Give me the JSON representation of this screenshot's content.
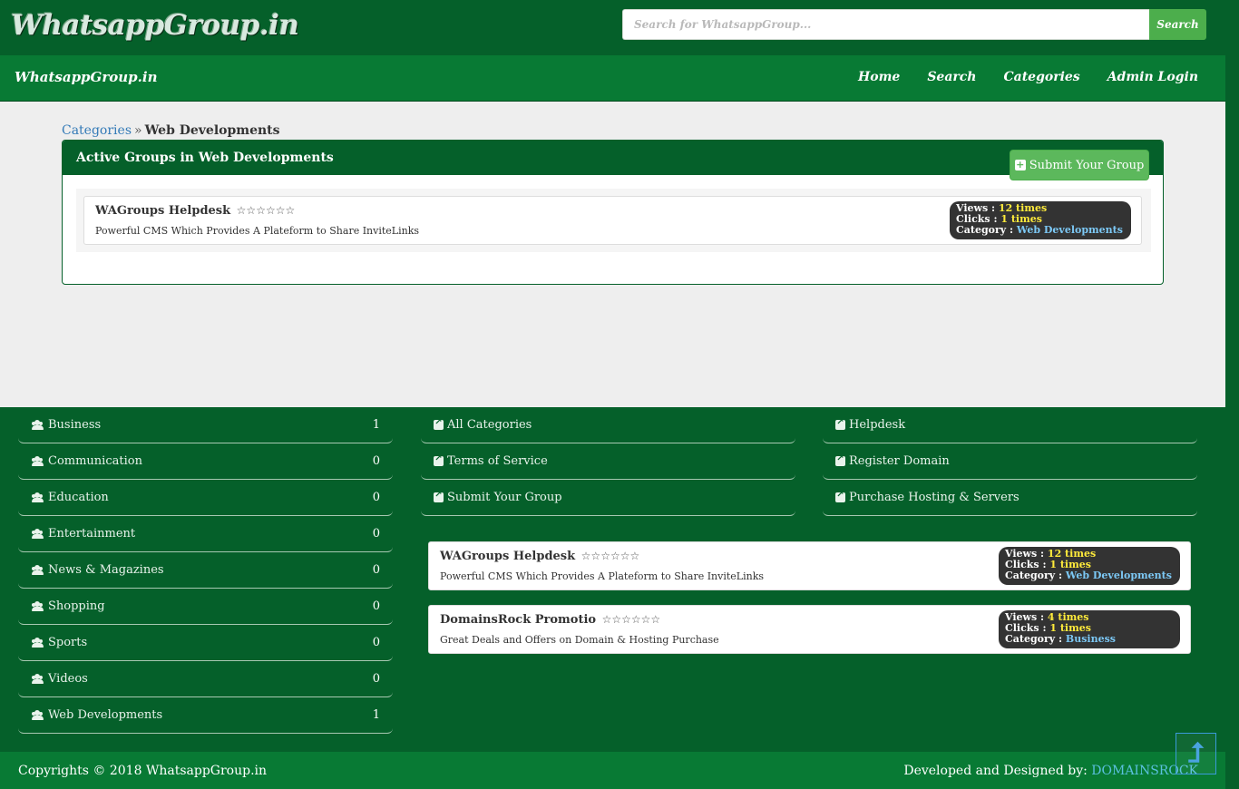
{
  "header": {
    "logo": "WhatsappGroup.in",
    "search_placeholder": "Search for WhatsappGroup...",
    "search_button": "Search"
  },
  "navbar": {
    "brand": "WhatsappGroup.in",
    "links": [
      "Home",
      "Search",
      "Categories",
      "Admin Login"
    ]
  },
  "breadcrumb": {
    "parent": "Categories",
    "separator": "»",
    "current": "Web Developments"
  },
  "panel": {
    "title": "Active Groups in Web Developments",
    "submit_button": "Submit Your Group",
    "groups": [
      {
        "name": "WAGroups Helpdesk",
        "rating": 0,
        "stars": "☆☆☆☆☆☆",
        "description": "Powerful CMS Which Provides A Plateform to Share InviteLinks",
        "views_label": "Views :",
        "views": "12 times",
        "clicks_label": "Clicks :",
        "clicks": "1 times",
        "category_label": "Category :",
        "category": "Web Developments"
      }
    ]
  },
  "footer": {
    "categories": [
      {
        "label": "Business",
        "count": "1"
      },
      {
        "label": "Communication",
        "count": "0"
      },
      {
        "label": "Education",
        "count": "0"
      },
      {
        "label": "Entertainment",
        "count": "0"
      },
      {
        "label": "News & Magazines",
        "count": "0"
      },
      {
        "label": "Shopping",
        "count": "0"
      },
      {
        "label": "Sports",
        "count": "0"
      },
      {
        "label": "Videos",
        "count": "0"
      },
      {
        "label": "Web Developments",
        "count": "1"
      }
    ],
    "links_middle": [
      "All Categories",
      "Terms of Service",
      "Submit Your Group"
    ],
    "links_right": [
      "Helpdesk",
      "Register Domain",
      "Purchase Hosting & Servers"
    ],
    "featured": [
      {
        "name": "WAGroups Helpdesk",
        "stars": "☆☆☆☆☆☆",
        "description": "Powerful CMS Which Provides A Plateform to Share InviteLinks",
        "views_label": "Views :",
        "views": "12 times",
        "clicks_label": "Clicks :",
        "clicks": "1 times",
        "category_label": "Category :",
        "category": "Web Developments"
      },
      {
        "name": "DomainsRock Promotio",
        "stars": "☆☆☆☆☆☆",
        "description": "Great Deals and Offers on Domain & Hosting Purchase",
        "views_label": "Views :",
        "views": "4 times",
        "clicks_label": "Clicks :",
        "clicks": "1 times",
        "category_label": "Category :",
        "category": "Business"
      }
    ]
  },
  "copyright": {
    "left": "Copyrights © 2018 WhatsappGroup.in",
    "right_prefix": "Developed and Designed by:",
    "right_link": "DOMAINSROCK"
  },
  "colors": {
    "dark_green": "#05602a",
    "nav_green": "#087a34",
    "button_green": "#5cb85c",
    "link_blue": "#337ab7",
    "stats_bg": "#333333",
    "stats_value": "#ffeb3b"
  }
}
